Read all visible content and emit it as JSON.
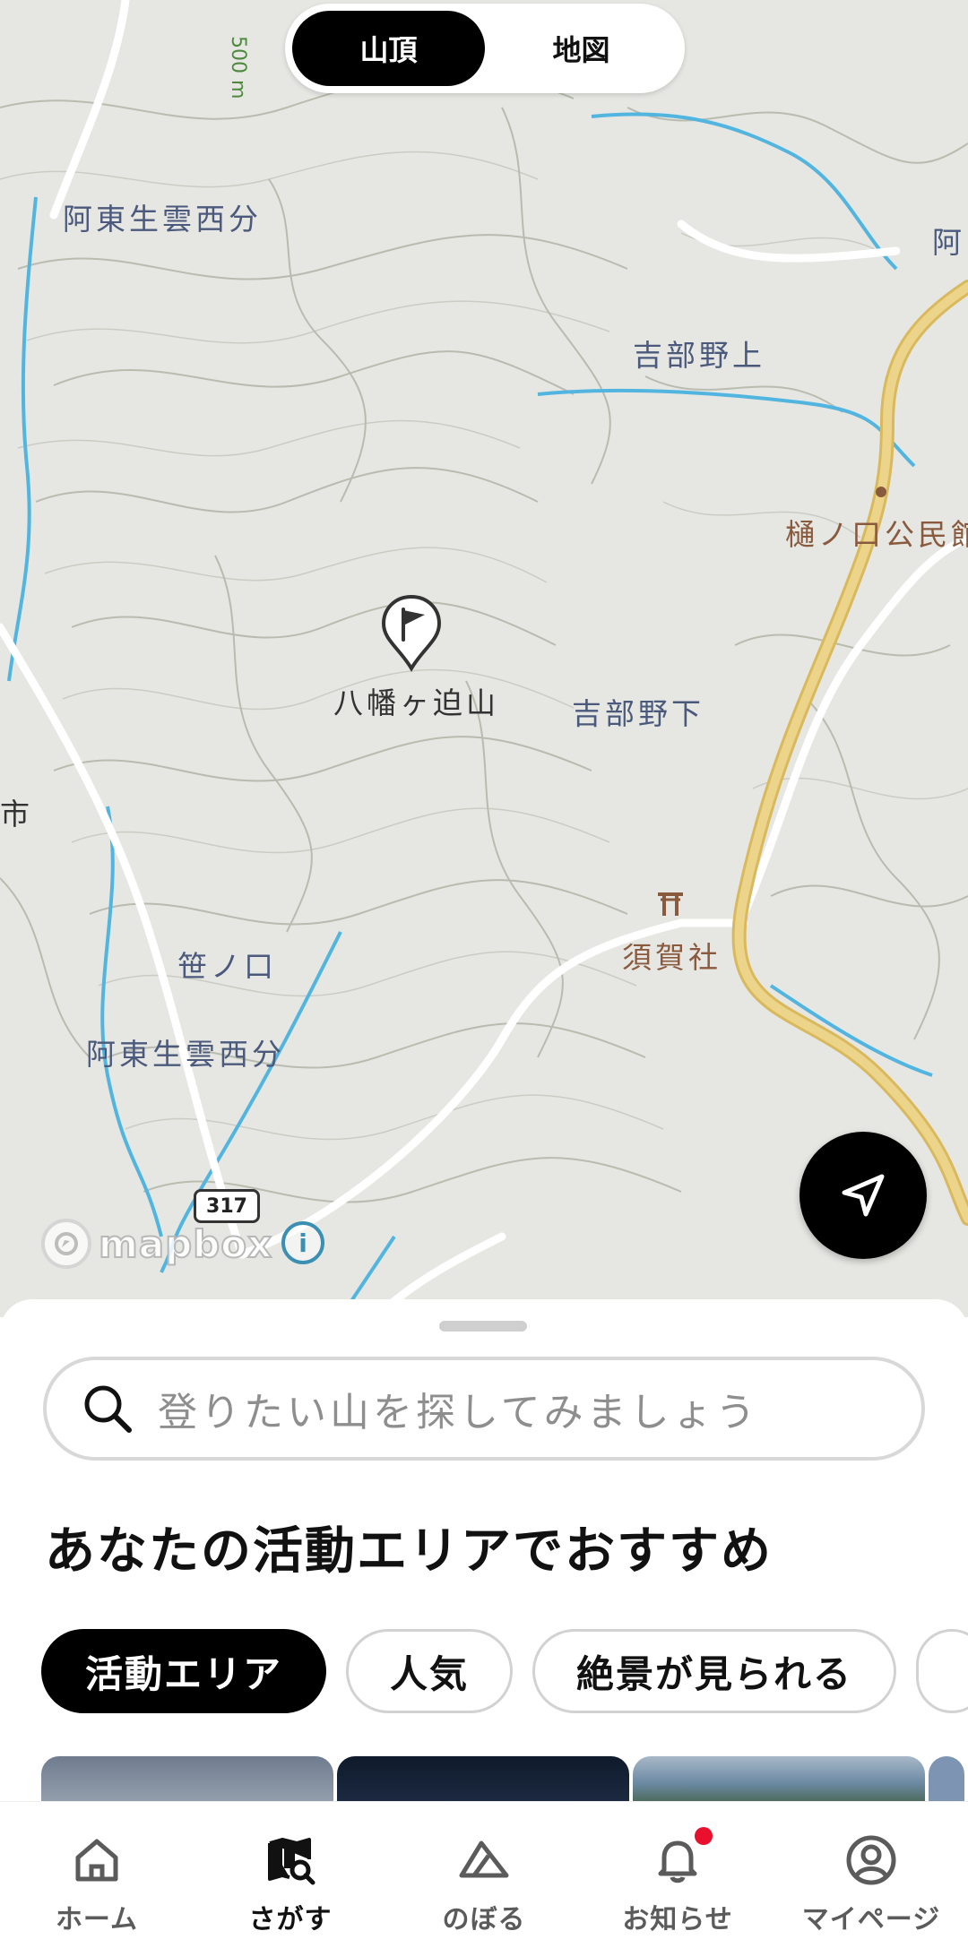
{
  "segment": {
    "items": [
      "山頂",
      "地図"
    ],
    "active_index": 0
  },
  "map": {
    "labels": {
      "elevation": "500 m",
      "place_1": "阿東生雲西分",
      "place_2": "吉部野上",
      "place_3": "樋ノ口公民館",
      "peak": "八幡ヶ迫山",
      "place_4": "吉部野下",
      "place_5": "笹ノ口",
      "place_6": "阿東生雲西分",
      "shrine": "須賀社",
      "edge_left": "市",
      "edge_right": "阿"
    },
    "route_shield": "317",
    "attribution": "mapbox"
  },
  "sheet": {
    "search_placeholder": "登りたい山を探してみましょう",
    "section_title": "あなたの活動エリアでおすすめ",
    "chips": [
      "活動エリア",
      "人気",
      "絶景が見られる"
    ],
    "active_chip_index": 0
  },
  "nav": {
    "items": [
      {
        "label": "ホーム",
        "icon": "home-icon"
      },
      {
        "label": "さがす",
        "icon": "map-search-icon"
      },
      {
        "label": "のぼる",
        "icon": "mountain-icon"
      },
      {
        "label": "お知らせ",
        "icon": "bell-icon"
      },
      {
        "label": "マイページ",
        "icon": "user-circle-icon"
      }
    ],
    "active_index": 1
  },
  "colors": {
    "accent": "#000000",
    "notification": "#e8102c",
    "road": "#e4c776",
    "water": "#52b5e0"
  }
}
